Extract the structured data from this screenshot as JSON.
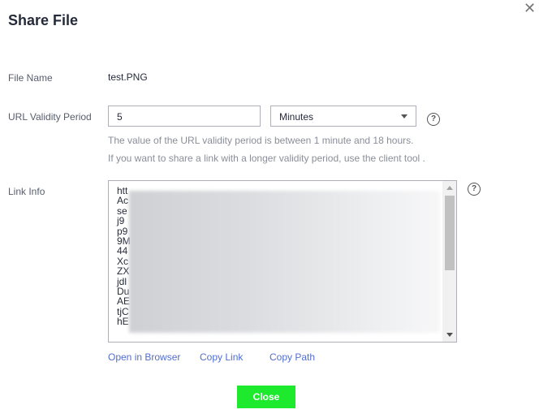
{
  "dialog": {
    "title": "Share File",
    "close_icon": "close-icon"
  },
  "file_name": {
    "label": "File Name",
    "value": "test.PNG"
  },
  "validity": {
    "label": "URL Validity Period",
    "value": "5",
    "unit": "Minutes",
    "hint1": "The value of the URL validity period is between 1 minute and 18 hours.",
    "hint2": "If you want to share a link with a longer validity period, use the client tool ."
  },
  "link_info": {
    "label": "Link Info",
    "visible_line_starts": [
      "htt",
      "Ac",
      "se",
      "j9",
      "p9",
      "9M",
      "44",
      "Xc",
      "ZX",
      "jdl",
      "Du",
      "AE",
      "tjC",
      "hE"
    ]
  },
  "actions": {
    "open": "Open in Browser",
    "copy_link": "Copy Link",
    "copy_path": "Copy Path",
    "close": "Close"
  },
  "colors": {
    "accent_button": "#1dea2d",
    "link": "#526ecc"
  }
}
